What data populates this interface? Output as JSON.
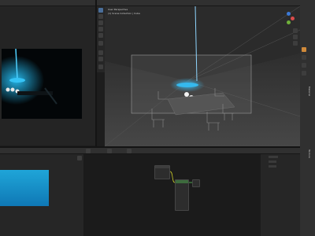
{
  "left_top": {
    "header_text": ""
  },
  "viewport": {
    "overlay_lines": [
      "User Perspective",
      "(1) Scene Collection | Cube"
    ],
    "nav_gizmo": {
      "x": "X",
      "y": "Y",
      "z": "Z"
    },
    "frame_label": ""
  },
  "node_editor": {
    "header_items": [
      "",
      "",
      "",
      "",
      ""
    ],
    "node_title": ""
  },
  "image_editor": {
    "header_text": ""
  },
  "properties": {
    "tabs": [
      "Object",
      "Modifiers",
      "Particles",
      "Physics",
      "Constraints",
      "Data",
      "Material",
      "Texture"
    ]
  },
  "colors": {
    "accent": "#4a6e9a",
    "render_cyan": "#1fa5d8",
    "x_axis": "#d94c4c",
    "y_axis": "#6fb03a",
    "z_axis": "#3c79d6"
  }
}
